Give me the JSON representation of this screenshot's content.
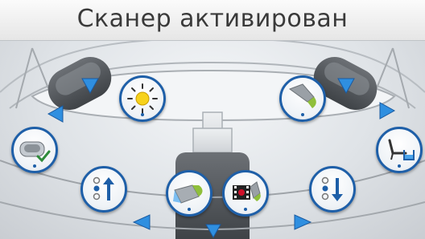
{
  "screen": {
    "title": "Сканер активирован"
  },
  "colors": {
    "accent_blue": "#1e5fa8",
    "arrow_blue": "#2f8fe0",
    "icon_green": "#2e8b3a",
    "film_red": "#d0102a"
  },
  "controls": {
    "brightness": {
      "icon": "sun-icon"
    },
    "instrument_right": {
      "icon": "scaler-tip-icon"
    },
    "chair_status": {
      "icon": "chair-check-icon"
    },
    "water_supply": {
      "icon": "chair-water-icon"
    },
    "program_up": {
      "icon": "program-up-icon"
    },
    "program_down": {
      "icon": "program-down-icon"
    },
    "scanner_tip": {
      "icon": "scanner-tip-icon"
    },
    "camera_record": {
      "icon": "film-record-icon"
    }
  }
}
